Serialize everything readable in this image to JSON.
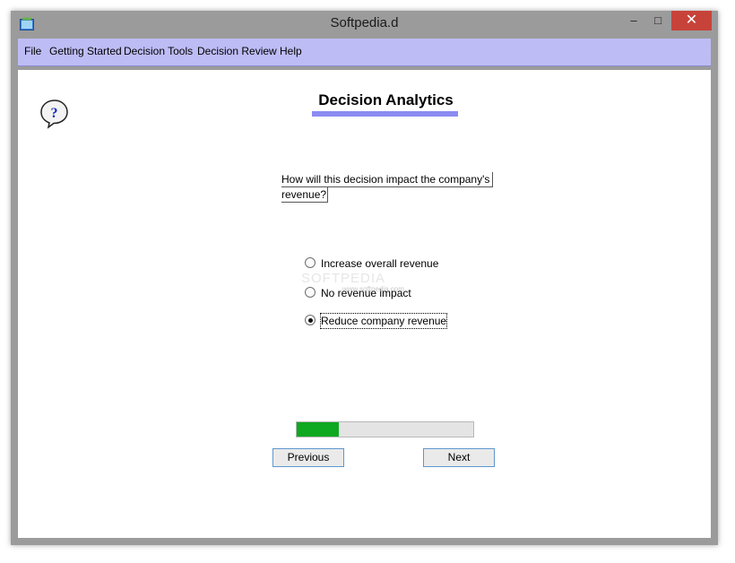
{
  "window": {
    "title": "Softpedia.d",
    "controls": {
      "minimize": "–",
      "maximize": "□",
      "close": "✕"
    }
  },
  "menu": {
    "items": [
      {
        "label": "File"
      },
      {
        "label": "Getting Started"
      },
      {
        "label": "Decision Tools"
      },
      {
        "label": "Decision Review"
      },
      {
        "label": "Help"
      }
    ]
  },
  "page": {
    "heading": "Decision Analytics",
    "help_icon": "question-icon",
    "question_line1": "How will this decision impact the company's",
    "question_line2": "revenue?"
  },
  "options": [
    {
      "label": "Increase overall revenue",
      "selected": false
    },
    {
      "label": "No revenue impact",
      "selected": false
    },
    {
      "label": "Reduce company revenue",
      "selected": true
    }
  ],
  "watermark": {
    "text": "SOFTPEDIA",
    "url": "www.softpedia.com"
  },
  "progress": {
    "fraction": 0.24,
    "fill_color": "#0fa821"
  },
  "buttons": {
    "previous": "Previous",
    "next": "Next"
  },
  "colors": {
    "menubar": "#bdbcf5",
    "heading_underline": "#8b8bf2",
    "close_button": "#c7433a"
  }
}
